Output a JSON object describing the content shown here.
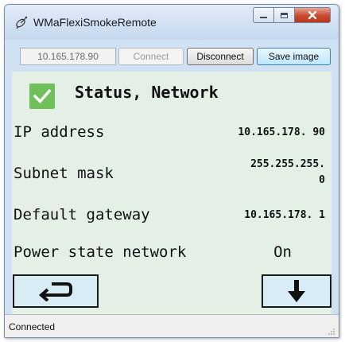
{
  "window": {
    "title": "WMaFlexiSmokeRemote",
    "app_icon": "satellite-dish-icon",
    "caption_buttons": [
      "minimize-icon",
      "maximize-icon",
      "close-icon"
    ]
  },
  "toolbar": {
    "ip_value": "10.165.178.90",
    "connect_label": "Connect",
    "disconnect_label": "Disconnect",
    "save_label": "Save image"
  },
  "status_section": {
    "checkbox_checked": true,
    "title": "Status, Network",
    "rows": [
      {
        "label": "IP address",
        "value": "10.165.178. 90"
      },
      {
        "label": "Subnet mask",
        "value": "255.255.255. 0"
      },
      {
        "label": "Default gateway",
        "value": "10.165.178. 1"
      },
      {
        "label": "Power state network",
        "value": "On"
      }
    ]
  },
  "nav": {
    "back_icon": "return-arrow-icon",
    "down_icon": "down-arrow-icon"
  },
  "statusbar": {
    "text": "Connected"
  },
  "colors": {
    "content_bg": "#e4f0e6",
    "check_green": "#6fc05a",
    "nav_button_bg": "#d8ecf5",
    "window_chrome": "#cfe1f3"
  }
}
